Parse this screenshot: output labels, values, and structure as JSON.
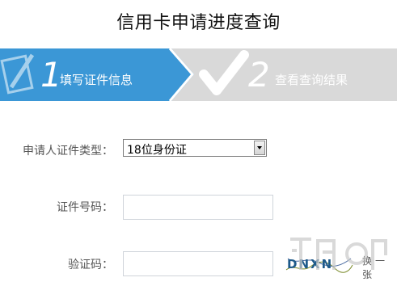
{
  "page": {
    "title": "信用卡申请进度查询"
  },
  "steps": [
    {
      "number": "1",
      "label": "填写证件信息",
      "state": "active",
      "color": "#3b97d6"
    },
    {
      "number": "2",
      "label": "查看查询结果",
      "state": "inactive",
      "color": "#d8d8d8"
    }
  ],
  "form": {
    "id_type": {
      "label": "申请人证件类型：",
      "value": "18位身份证"
    },
    "id_number": {
      "label": "证件号码：",
      "value": ""
    },
    "captcha": {
      "label": "验证码：",
      "value": "",
      "image_text": "DNXN",
      "refresh_label": "换一张"
    }
  }
}
